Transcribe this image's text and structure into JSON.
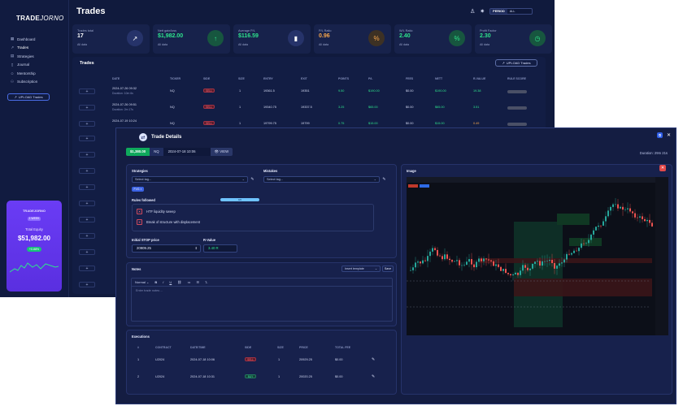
{
  "app": {
    "logo_bold": "TRADE",
    "logo_light": "JORNO",
    "page_title": "Trades",
    "period_label": "PERIOD",
    "period_value": "ALL"
  },
  "sidebar": {
    "items": [
      {
        "label": "Dashboard",
        "icon": "dashboard-icon"
      },
      {
        "label": "Trades",
        "icon": "trades-icon"
      },
      {
        "label": "Strategies",
        "icon": "strategies-icon"
      },
      {
        "label": "Journal",
        "icon": "journal-icon"
      },
      {
        "label": "Mentorship",
        "icon": "mentorship-icon"
      },
      {
        "label": "Subscription",
        "icon": "subscription-icon"
      }
    ],
    "upload_label": "UPLOAD Trades"
  },
  "equity": {
    "brand": "TRADEJORNO",
    "badge": "1 WEEK",
    "label": "Total Equity",
    "value": "$51,982.00",
    "change": "+0.88%"
  },
  "stats": [
    {
      "label": "Trades total",
      "value": "17",
      "sub": "All data",
      "color": "#ffffff",
      "icon_bg": "#26336a",
      "icon": "↗"
    },
    {
      "label": "Nett gain/loss",
      "value": "$1,982.00",
      "sub": "All data",
      "color": "#2ee38c",
      "icon_bg": "#17563f",
      "icon": "↑"
    },
    {
      "label": "Average P/L",
      "value": "$116.59",
      "sub": "All data",
      "color": "#2ee38c",
      "icon_bg": "#26336a",
      "icon": "▮"
    },
    {
      "label": "P/L Ratio",
      "value": "0.96",
      "sub": "All data",
      "color": "#f7a64b",
      "icon_bg": "#3d3124",
      "icon": "%"
    },
    {
      "label": "W/L Ratio",
      "value": "2.40",
      "sub": "All data",
      "color": "#2ee38c",
      "icon_bg": "#17563f",
      "icon": "%"
    },
    {
      "label": "Profit Factor",
      "value": "2.30",
      "sub": "All data",
      "color": "#2ee38c",
      "icon_bg": "#17563f",
      "icon": "◷"
    }
  ],
  "trades": {
    "title": "Trades",
    "upload_label": "UPLOAD Trades",
    "columns": [
      "DATE",
      "TICKER",
      "SIDE",
      "SIZE",
      "ENTRY",
      "EXIT",
      "POINTS",
      "P/L",
      "FEES",
      "NETT",
      "R-VALUE",
      "RULE SCORE"
    ],
    "rows": [
      {
        "date": "2024-07-26 09:32",
        "dur": "Duration: 10m 6s",
        "ticker": "NQ",
        "side": "SELL",
        "size": "1",
        "entry": "19361.5",
        "exit": "19351",
        "points": "9.50",
        "pl": "$190.00",
        "fees": "$0.00",
        "nett": "$190.00",
        "r": "19.38"
      },
      {
        "date": "2024-07-26 09:51",
        "dur": "Duration: 2m 17s",
        "ticker": "NQ",
        "side": "SELL",
        "size": "1",
        "entry": "19340.75",
        "exit": "19337.5",
        "points": "3.25",
        "pl": "$65.00",
        "fees": "$0.00",
        "nett": "$65.00",
        "r": "3.51"
      },
      {
        "date": "2024-07-19 10:24",
        "dur": "",
        "ticker": "NQ",
        "side": "SELL",
        "size": "1",
        "entry": "19799.75",
        "exit": "19799",
        "points": "0.75",
        "pl": "$15.00",
        "fees": "$0.00",
        "nett": "$15.00",
        "r": "0.49"
      }
    ]
  },
  "modal": {
    "title": "Trade Details",
    "pnl": "$1,380.00",
    "symbol": "NQ",
    "date": "2024-07-18 10:06",
    "view_label": "VIEW",
    "duration": "Duration: 29m 21s",
    "strategies_label": "Strategies",
    "strategies_placeholder": "Select tag...",
    "mistakes_label": "Mistakes",
    "mistakes_placeholder": "Select tag...",
    "tag": "FVG",
    "rules_label": "Rules followed",
    "rules_progress": 0.0,
    "rules_progress_text": "0/2",
    "rules": [
      "HTF liquidity sweep",
      "Break of structure with displacement"
    ],
    "stop_label": "Initial STOP price",
    "stop_value": "20909.25",
    "rvalue_label": "R-Value",
    "rvalue_value": "3.40 R",
    "image_label": "Image",
    "notes_label": "Notes",
    "template_label": "Insert template",
    "save_label": "Save",
    "editor_format": "Normal",
    "editor_placeholder": "Enter trade notes ...",
    "executions_label": "Executions",
    "exec_columns": [
      "#",
      "CONTRACT",
      "DATE/TIME",
      "SIDE",
      "SIZE",
      "PRICE",
      "TOTAL FEE"
    ],
    "executions": [
      {
        "n": "1",
        "contract": "U2024",
        "dt": "2024-07-18 10:06",
        "side": "SELL",
        "size": "1",
        "price": "20929.25",
        "fee": "$0.00"
      },
      {
        "n": "2",
        "contract": "U2024",
        "dt": "2024-07-18 10:31",
        "side": "BUY",
        "size": "1",
        "price": "20020.25",
        "fee": "$0.00"
      }
    ]
  },
  "colors": {
    "accent": "#3b62e4",
    "profit": "#2ee38c",
    "loss": "#ff6b7d",
    "bg": "#101a3d"
  }
}
